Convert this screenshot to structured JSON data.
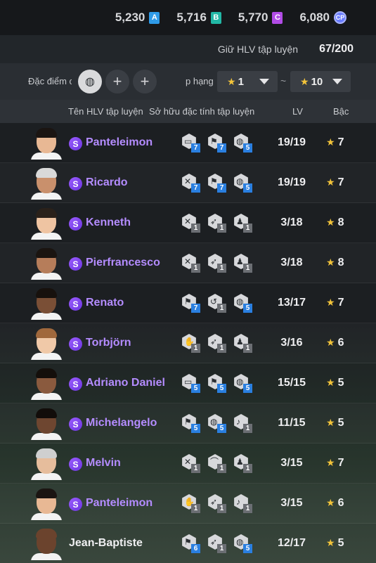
{
  "currencies": [
    {
      "value": "5,230",
      "badge": "A",
      "color": "#2f9be8"
    },
    {
      "value": "5,716",
      "badge": "B",
      "color": "#22b8a6"
    },
    {
      "value": "5,770",
      "badge": "C",
      "color": "#b14ce6"
    },
    {
      "value": "6,080",
      "badge": "CP",
      "color": "#6a7cff"
    }
  ],
  "holding": {
    "label": "Giữ HLV tập luyện",
    "value": "67/200"
  },
  "filter": {
    "trait_label": "Đặc điểm c",
    "rank_label": "p hạng",
    "rank_from": "1",
    "rank_to": "10",
    "tilde": "~"
  },
  "table_header": {
    "name": "Tên HLV tập luyện",
    "traits": "Sở hữu đặc tính tập luyện",
    "lv": "LV",
    "rank": "Bậc"
  },
  "coaches": [
    {
      "name": "Panteleimon",
      "special": true,
      "lv": "19/19",
      "rank": "7",
      "skin": "#e8b894",
      "hair": "#1b1512",
      "traits": [
        {
          "icon": "screen-icon",
          "level": "7",
          "tier": "blue"
        },
        {
          "icon": "run-icon",
          "level": "7",
          "tier": "blue"
        },
        {
          "icon": "ball-icon",
          "level": "5",
          "tier": "blue"
        }
      ]
    },
    {
      "name": "Ricardo",
      "special": true,
      "lv": "19/19",
      "rank": "7",
      "skin": "#c9906c",
      "hair": "#d9d9d9",
      "traits": [
        {
          "icon": "tackle-icon",
          "level": "7",
          "tier": "blue"
        },
        {
          "icon": "run-icon",
          "level": "7",
          "tier": "blue"
        },
        {
          "icon": "ball-icon",
          "level": "5",
          "tier": "blue"
        }
      ]
    },
    {
      "name": "Kenneth",
      "special": true,
      "lv": "3/18",
      "rank": "8",
      "skin": "#efc4a2",
      "hair": "#2a211a",
      "traits": [
        {
          "icon": "tackle-icon",
          "level": "1",
          "tier": "grey"
        },
        {
          "icon": "kick-icon",
          "level": "1",
          "tier": "grey"
        },
        {
          "icon": "player-icon",
          "level": "1",
          "tier": "grey"
        }
      ]
    },
    {
      "name": "Pierfrancesco",
      "special": true,
      "lv": "3/18",
      "rank": "8",
      "skin": "#b67d5a",
      "hair": "#1a1410",
      "traits": [
        {
          "icon": "tackle-icon",
          "level": "1",
          "tier": "grey"
        },
        {
          "icon": "kick-icon",
          "level": "1",
          "tier": "grey"
        },
        {
          "icon": "player-icon",
          "level": "1",
          "tier": "grey"
        }
      ]
    },
    {
      "name": "Renato",
      "special": true,
      "lv": "13/17",
      "rank": "7",
      "skin": "#7a4f36",
      "hair": "#17110d",
      "traits": [
        {
          "icon": "run-icon",
          "level": "7",
          "tier": "blue"
        },
        {
          "icon": "dribble-icon",
          "level": "1",
          "tier": "grey"
        },
        {
          "icon": "ball-icon",
          "level": "5",
          "tier": "blue"
        }
      ]
    },
    {
      "name": "Torbjörn",
      "special": true,
      "lv": "3/16",
      "rank": "6",
      "skin": "#f0c9a8",
      "hair": "#a0683c",
      "traits": [
        {
          "icon": "keeper-icon",
          "level": "1",
          "tier": "grey"
        },
        {
          "icon": "kick-icon",
          "level": "1",
          "tier": "grey"
        },
        {
          "icon": "player-icon",
          "level": "1",
          "tier": "grey"
        }
      ]
    },
    {
      "name": "Adriano Daniel",
      "special": true,
      "lv": "15/15",
      "rank": "5",
      "skin": "#8a5a3e",
      "hair": "#140f0b",
      "traits": [
        {
          "icon": "screen-icon",
          "level": "5",
          "tier": "blue"
        },
        {
          "icon": "run-icon",
          "level": "5",
          "tier": "blue"
        },
        {
          "icon": "ball-icon",
          "level": "5",
          "tier": "blue"
        }
      ]
    },
    {
      "name": "Michelangelo",
      "special": true,
      "lv": "11/15",
      "rank": "5",
      "skin": "#6e4630",
      "hair": "#120d0a",
      "traits": [
        {
          "icon": "run-icon",
          "level": "5",
          "tier": "blue"
        },
        {
          "icon": "ball-icon",
          "level": "5",
          "tier": "blue"
        },
        {
          "icon": "whistle-icon",
          "level": "1",
          "tier": "grey"
        }
      ]
    },
    {
      "name": "Melvin",
      "special": true,
      "lv": "3/15",
      "rank": "7",
      "skin": "#e6bd9c",
      "hair": "#cfcfcf",
      "traits": [
        {
          "icon": "tackle-icon",
          "level": "1",
          "tier": "grey"
        },
        {
          "icon": "header-icon",
          "level": "1",
          "tier": "grey"
        },
        {
          "icon": "player-icon",
          "level": "1",
          "tier": "grey"
        }
      ]
    },
    {
      "name": "Panteleimon",
      "special": true,
      "lv": "3/15",
      "rank": "6",
      "skin": "#e8b894",
      "hair": "#1b1512",
      "traits": [
        {
          "icon": "keeper-icon",
          "level": "1",
          "tier": "grey"
        },
        {
          "icon": "kick-icon",
          "level": "1",
          "tier": "grey"
        },
        {
          "icon": "whistle-icon",
          "level": "1",
          "tier": "grey"
        }
      ]
    },
    {
      "name": "Jean-Baptiste",
      "special": false,
      "lv": "12/17",
      "rank": "5",
      "skin": "#6b432d",
      "hair": "#6b432d",
      "traits": [
        {
          "icon": "run-icon",
          "level": "6",
          "tier": "blue"
        },
        {
          "icon": "kick-icon",
          "level": "1",
          "tier": "grey"
        },
        {
          "icon": "ball-icon",
          "level": "5",
          "tier": "blue"
        }
      ]
    }
  ],
  "glyphs": {
    "screen-icon": "▭",
    "run-icon": "⚑",
    "ball-icon": "◍",
    "tackle-icon": "✕",
    "kick-icon": "➶",
    "player-icon": "♟",
    "dribble-icon": "↺",
    "keeper-icon": "✋",
    "whistle-icon": "♪",
    "header-icon": "⌒"
  }
}
